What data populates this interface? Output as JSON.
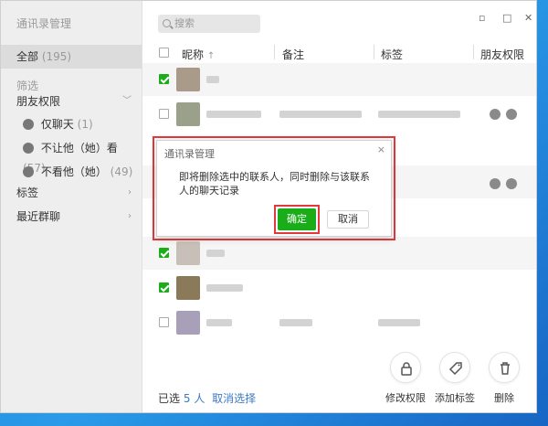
{
  "window": {
    "title": "通讯录管理",
    "controls": {
      "minimize": "▫",
      "maximize": "□",
      "close": "✕"
    }
  },
  "sidebar": {
    "all_label": "全部",
    "all_count": "(195)",
    "filter_label": "筛选",
    "friend_perm": "朋友权限",
    "items": [
      {
        "label": "仅聊天",
        "count": "(1)"
      },
      {
        "label": "不让他（她）看",
        "count": "(57)"
      },
      {
        "label": "不看他（她）",
        "count": "(49)"
      }
    ],
    "tags": "标签",
    "recent_groups": "最近群聊"
  },
  "search": {
    "placeholder": "搜索"
  },
  "table": {
    "columns": {
      "nickname": "昵称",
      "sort_arrow": "↑",
      "remark": "备注",
      "tags": "标签",
      "perm": "朋友权限"
    }
  },
  "footer": {
    "selected_prefix": "已选",
    "selected_count": "5",
    "selected_unit": "人",
    "clear_link": "取消选择"
  },
  "actions": [
    {
      "label": "修改权限",
      "icon": "lock-icon"
    },
    {
      "label": "添加标签",
      "icon": "tag-icon"
    },
    {
      "label": "删除",
      "icon": "trash-icon"
    }
  ],
  "dialog": {
    "title": "通讯录管理",
    "close": "×",
    "message": "即将删除选中的联系人，同时删除与该联系人的聊天记录",
    "ok": "确定",
    "cancel": "取消"
  },
  "colors": {
    "accent": "#1aad19",
    "link": "#3a7ac4",
    "highlight": "#e23a3a"
  }
}
